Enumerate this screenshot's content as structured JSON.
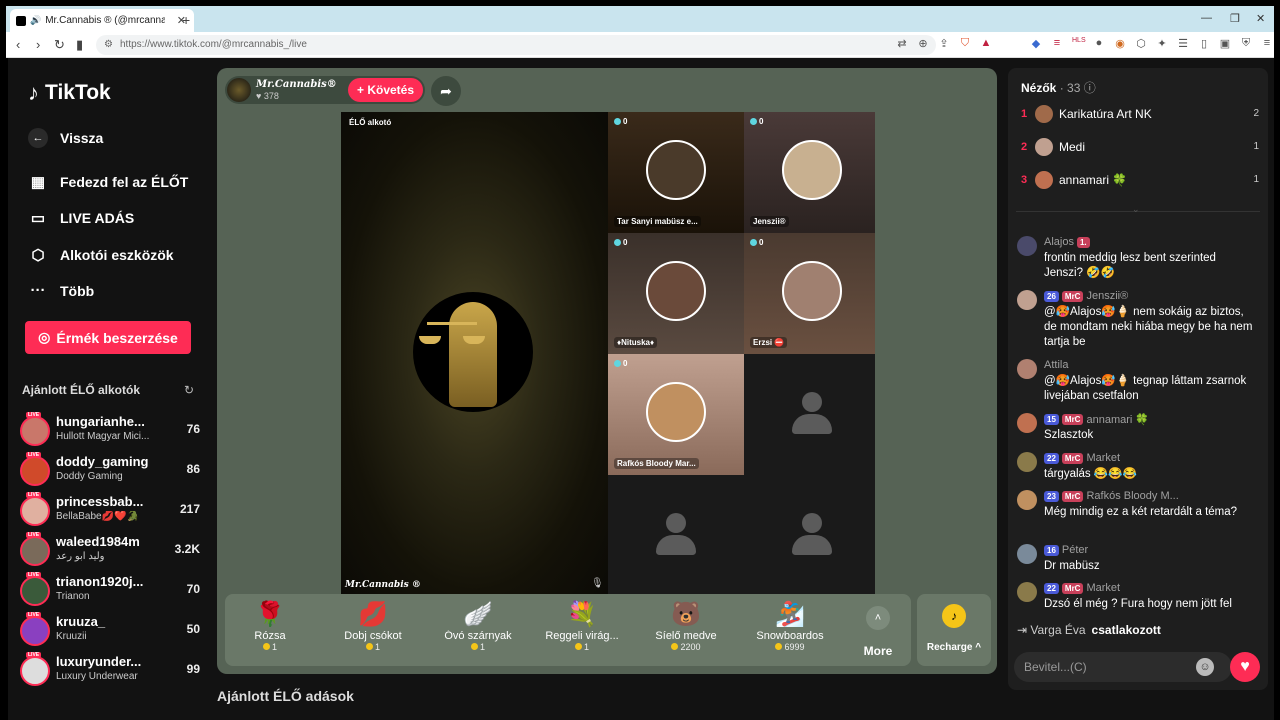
{
  "browser": {
    "tab_title": "Mr.Cannabis ® (@mrcannab",
    "url": "https://www.tiktok.com/@mrcannabis_/live"
  },
  "sidebar": {
    "logo": "TikTok",
    "nav": [
      {
        "label": "Vissza"
      },
      {
        "label": "Fedezd fel az ÉLŐT"
      },
      {
        "label": "LIVE ADÁS"
      },
      {
        "label": "Alkotói eszközök"
      },
      {
        "label": "Több"
      }
    ],
    "coins_button": "Érmék beszerzése",
    "recommended_title": "Ajánlott ÉLŐ alkotók",
    "creators": [
      {
        "name": "hungarianhe...",
        "sub": "Hullott Magyar Mici...",
        "count": "76",
        "color": "#c9776a"
      },
      {
        "name": "doddy_gaming",
        "sub": "Doddy Gaming",
        "count": "86",
        "color": "#d04a2a"
      },
      {
        "name": "princessbab...",
        "sub": "BellaBabe💋❤️🐊",
        "count": "217",
        "color": "#e0b0a0"
      },
      {
        "name": "waleed1984m",
        "sub": "وليد ابو رعد",
        "count": "3.2K",
        "color": "#7a6a5a"
      },
      {
        "name": "trianon1920j...",
        "sub": "Trianon",
        "count": "70",
        "color": "#3a5a3a"
      },
      {
        "name": "kruuza_",
        "sub": "Kruuzii",
        "count": "50",
        "color": "#8a40c0"
      },
      {
        "name": "luxuryunder...",
        "sub": "Luxury Underwear",
        "count": "99",
        "color": "#ddd"
      }
    ]
  },
  "stream": {
    "host_name": "Mr.Cannabis®",
    "likes": "378",
    "follow": "+ Követés",
    "main_tag": "ÉLŐ alkotó",
    "signature": "Mr.Cannabis ®",
    "guests": [
      {
        "count": "0",
        "name": "Tar Sanyi mabüsz e...",
        "color": "#4a3a2a"
      },
      {
        "count": "0",
        "name": "Jenszii®",
        "color": "#c8b090"
      },
      {
        "count": "0",
        "name": "♦Nituska♦",
        "color": "#6a4a3a"
      },
      {
        "count": "0",
        "name": "Erzsi ⛔",
        "color": "#a08070"
      },
      {
        "count": "0",
        "name": "Rafkós Bloody Mar...",
        "color": "#c09060"
      }
    ],
    "gifts": [
      {
        "name": "Rózsa",
        "price": "1",
        "icon": "🌹"
      },
      {
        "name": "Dobj csókot",
        "price": "1",
        "icon": "💋"
      },
      {
        "name": "Óvó szárnyak",
        "price": "1",
        "icon": "🪽"
      },
      {
        "name": "Reggeli virág...",
        "price": "1",
        "icon": "💐"
      },
      {
        "name": "Síelő medve",
        "price": "2200",
        "icon": "🐻"
      },
      {
        "name": "Snowboardos",
        "price": "6999",
        "icon": "🏂"
      }
    ],
    "more": "More",
    "recharge": "Recharge ^",
    "below_title": "Ajánlott ÉLŐ adások"
  },
  "viewers": {
    "title": "Nézők",
    "count": "· 33",
    "top": [
      {
        "rank": "1",
        "name": "Karikatúra Art NK",
        "value": "2",
        "color": "#a06a4a"
      },
      {
        "rank": "2",
        "name": "Medi",
        "value": "1",
        "color": "#c0a090"
      },
      {
        "rank": "3",
        "name": "annamari 🍀",
        "value": "1",
        "color": "#c07050"
      }
    ]
  },
  "chat": [
    {
      "header": "Alajos",
      "badges": [
        "1."
      ],
      "text": "frontin meddig lesz bent szerinted Jenszi? 🤣🤣",
      "color": "#4a4a6a"
    },
    {
      "header": "Jenszii®",
      "lvl": "26",
      "mrc": "MrC",
      "text": "@🥵Alajos🥵🍦 nem sokáig az biztos, de mondtam neki hiába megy be ha nem tartja be",
      "color": "#c0a090"
    },
    {
      "header": "Attila",
      "text": "@🥵Alajos🥵🍦 tegnap láttam zsarnok livejában csetfalon",
      "color": "#b08070"
    },
    {
      "header": "annamari 🍀",
      "lvl": "15",
      "mrc": "MrC",
      "text": "Szlasztok",
      "color": "#c07050"
    },
    {
      "header": "Market",
      "lvl": "22",
      "mrc": "MrC",
      "text": "tárgyalás 😂😂😂",
      "color": "#8a7a4a"
    },
    {
      "header": "Rafkós Bloody M...",
      "lvl": "23",
      "mrc": "MrC",
      "text": "Még mindig ez a két retardált a téma?",
      "color": "#c09060"
    },
    {
      "header": "Péter",
      "lvl": "16",
      "text": "Dr mabüsz",
      "color": "#7a8a9a"
    },
    {
      "header": "Market",
      "lvl": "22",
      "mrc": "MrC",
      "text": "Dzsó él még ? Fura hogy nem jött fel",
      "color": "#8a7a4a"
    }
  ],
  "joined": {
    "name": "Varga Éva",
    "action": "csatlakozott"
  },
  "input_placeholder": "Bevitel...(C)"
}
